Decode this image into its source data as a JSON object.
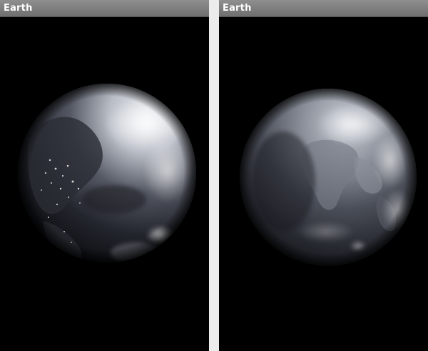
{
  "screens": [
    {
      "title": "Earth",
      "globe_view": "americas-night-side",
      "globe_icon": "earth-globe-image"
    },
    {
      "title": "Earth",
      "globe_view": "africa-middle-east-view",
      "globe_icon": "earth-globe-image"
    }
  ],
  "colors": {
    "title_bar": "#7f7f7f",
    "title_text": "#ffffff",
    "background": "#000000",
    "divider": "#ececec"
  }
}
